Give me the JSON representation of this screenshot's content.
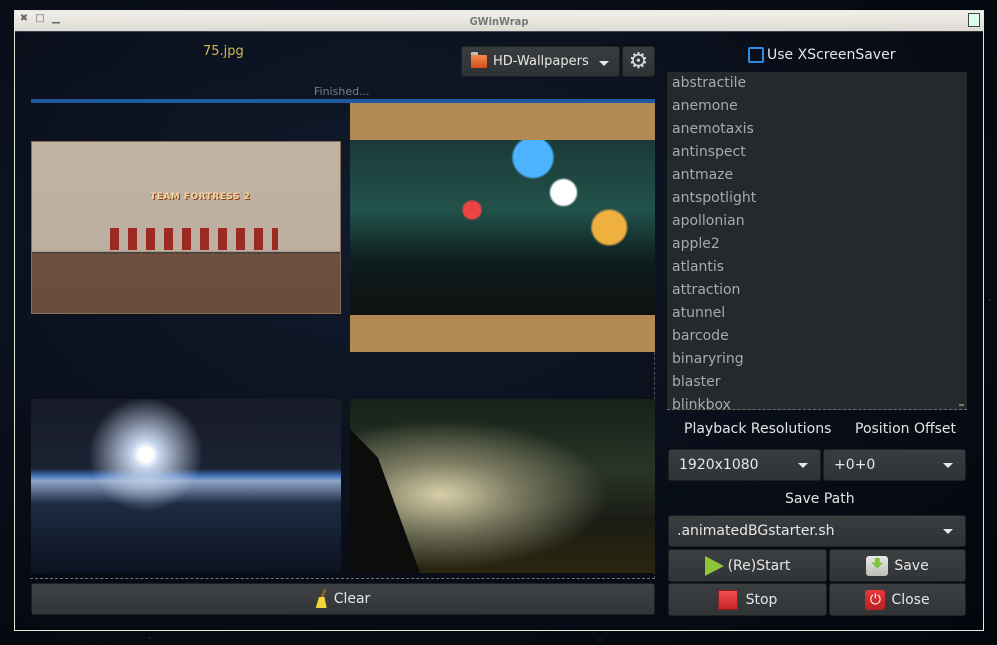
{
  "window": {
    "title": "GWinWrap",
    "controls": [
      "close",
      "maximize",
      "minimize"
    ]
  },
  "header": {
    "selected_file": "75.jpg",
    "status": "Finished...",
    "progress_percent": 100,
    "folder_select": {
      "value": "HD-Wallpapers"
    },
    "settings_icon": "gear-icon"
  },
  "thumbnails": [
    {
      "name": "team-fortress-2",
      "text": "TEAM FORTRESS 2"
    },
    {
      "name": "city-night-street"
    },
    {
      "name": "earth-sunrise-space-station"
    },
    {
      "name": "cloaked-figure-landscape"
    }
  ],
  "clear_button": {
    "label": "Clear",
    "icon": "broom-icon"
  },
  "xscreensaver": {
    "label": "Use XScreenSaver",
    "checked": false
  },
  "screensaver_list": [
    "abstractile",
    "anemone",
    "anemotaxis",
    "antinspect",
    "antmaze",
    "antspotlight",
    "apollonian",
    "apple2",
    "atlantis",
    "attraction",
    "atunnel",
    "barcode",
    "binaryring",
    "blaster",
    "blinkbox"
  ],
  "playback": {
    "label": "Playback Resolutions",
    "value": "1920x1080"
  },
  "offset": {
    "label": "Position Offset",
    "value": "+0+0"
  },
  "save_path": {
    "label": "Save Path",
    "value": ".animatedBGstarter.sh"
  },
  "buttons": {
    "restart": "(Re)Start",
    "save": "Save",
    "stop": "Stop",
    "close": "Close"
  }
}
